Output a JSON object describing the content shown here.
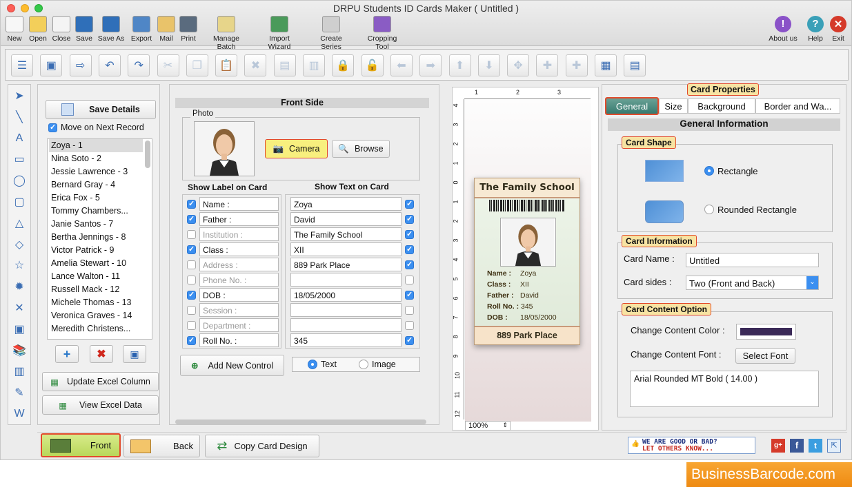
{
  "app": {
    "title": "DRPU Students ID Cards Maker ( Untitled )"
  },
  "toolbar": {
    "items": [
      "New",
      "Open",
      "Close",
      "Save",
      "Save As",
      "Export",
      "Mail",
      "Print",
      "Manage Batch",
      "Import Wizard",
      "Create Series",
      "Cropping Tool"
    ],
    "right": [
      "About us",
      "Help",
      "Exit"
    ]
  },
  "left": {
    "save_details": "Save Details",
    "move_next": "Move on Next Record",
    "records": [
      "Zoya - 1",
      "Nina Soto - 2",
      "Jessie Lawrence - 3",
      "Bernard Gray - 4",
      "Erica Fox - 5",
      "Tommy Chambers...",
      "Janie Santos - 7",
      "Bertha Jennings - 8",
      "Victor Patrick - 9",
      "Amelia Stewart - 10",
      "Lance Walton - 11",
      "Russell Mack - 12",
      "Michele Thomas - 13",
      "Veronica Graves - 14",
      "Meredith Christens..."
    ],
    "update_excel": "Update Excel Column",
    "view_excel": "View Excel Data"
  },
  "front": {
    "header": "Front Side",
    "photo_label": "Photo",
    "camera": "Camera",
    "browse": "Browse",
    "show_label": "Show Label on Card",
    "show_text": "Show Text on Card",
    "rows": [
      {
        "label": "Name :",
        "value": "Zoya",
        "lc": true,
        "vc": true,
        "dim": false
      },
      {
        "label": "Father :",
        "value": "David",
        "lc": true,
        "vc": true,
        "dim": false
      },
      {
        "label": "Institution :",
        "value": "The Family School",
        "lc": false,
        "vc": true,
        "dim": true
      },
      {
        "label": "Class :",
        "value": "XII",
        "lc": true,
        "vc": true,
        "dim": false
      },
      {
        "label": "Address :",
        "value": "889 Park Place",
        "lc": false,
        "vc": true,
        "dim": true
      },
      {
        "label": "Phone No. :",
        "value": "",
        "lc": false,
        "vc": false,
        "dim": true
      },
      {
        "label": "DOB :",
        "value": "18/05/2000",
        "lc": true,
        "vc": true,
        "dim": false
      },
      {
        "label": "Session :",
        "value": "",
        "lc": false,
        "vc": false,
        "dim": true
      },
      {
        "label": "Department :",
        "value": "",
        "lc": false,
        "vc": false,
        "dim": true
      },
      {
        "label": "Roll No. :",
        "value": "345",
        "lc": true,
        "vc": true,
        "dim": false
      }
    ],
    "add_control": "Add New Control",
    "text_opt": "Text",
    "image_opt": "Image"
  },
  "card": {
    "school": "The Family School",
    "address": "889 Park Place",
    "zoom": "100%",
    "fields": [
      {
        "k": "Name :",
        "v": "Zoya"
      },
      {
        "k": "Class :",
        "v": "XII"
      },
      {
        "k": "Father :",
        "v": "David"
      },
      {
        "k": "Roll No. :",
        "v": "345"
      },
      {
        "k": "DOB :",
        "v": "18/05/2000"
      }
    ],
    "ruler_top": [
      "1",
      "2",
      "3"
    ],
    "ruler_left": [
      "4",
      "3",
      "2",
      "1",
      "0",
      "1",
      "2",
      "3",
      "4",
      "5",
      "6",
      "7",
      "8",
      "9",
      "10",
      "11",
      "12"
    ]
  },
  "props": {
    "title": "Card Properties",
    "tabs": [
      "General",
      "Size",
      "Background",
      "Border and Wa..."
    ],
    "general_info": "General Information",
    "card_shape": "Card Shape",
    "rect": "Rectangle",
    "rrect": "Rounded Rectangle",
    "card_info": "Card Information",
    "card_name_lbl": "Card Name :",
    "card_name": "Untitled",
    "card_sides_lbl": "Card sides :",
    "card_sides": "Two (Front and Back)",
    "content_opt": "Card Content Option",
    "change_color": "Change Content Color :",
    "change_font": "Change Content Font :",
    "select_font": "Select Font",
    "font_value": "Arial Rounded MT Bold ( 14.00 )",
    "content_color": "#3b2a58"
  },
  "bottom": {
    "front": "Front",
    "back": "Back",
    "copy": "Copy Card Design",
    "feedback1": "WE ARE GOOD OR BAD?",
    "feedback2": "LET OTHERS KNOW..."
  },
  "brand": "BusinessBarcode.com"
}
